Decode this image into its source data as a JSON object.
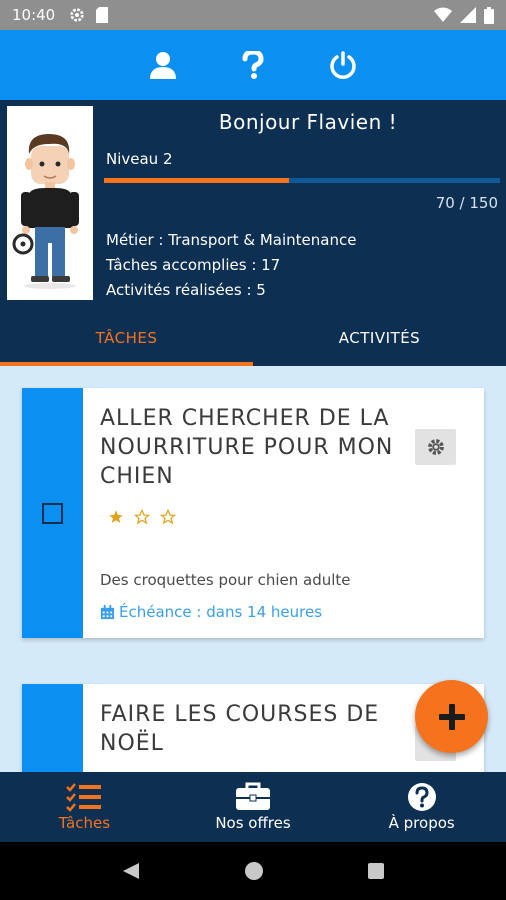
{
  "status_bar": {
    "time": "10:40",
    "icons": [
      "settings-icon",
      "sd-card-icon",
      "wifi-icon",
      "signal-icon",
      "battery-icon"
    ]
  },
  "top_bar": {
    "icons": [
      "user-icon",
      "question-icon",
      "power-icon"
    ]
  },
  "profile": {
    "greeting": "Bonjour Flavien !",
    "level": "Niveau 2",
    "xp_current": 70,
    "xp_max": 150,
    "xp_text": "70  / 150",
    "job": "Métier : Transport & Maintenance",
    "tasks_done": "Tâches accomplies : 17",
    "activities_done": "Activités réalisées : 5"
  },
  "tabs": [
    {
      "label": "TÂCHES",
      "active": true
    },
    {
      "label": "ACTIVITÉS",
      "active": false
    }
  ],
  "tasks": [
    {
      "title": "ALLER CHERCHER DE LA NOURRITURE POUR MON CHIEN",
      "stars_filled": 1,
      "stars_total": 3,
      "description": "Des croquettes pour chien adulte",
      "due": "Échéance : dans 14 heures"
    },
    {
      "title": "FAIRE LES COURSES DE NOËL"
    }
  ],
  "fab": {
    "icon": "plus-icon"
  },
  "bottom_nav": [
    {
      "label": "Tâches",
      "icon": "task-list-icon",
      "active": true
    },
    {
      "label": "Nos offres",
      "icon": "briefcase-icon",
      "active": false
    },
    {
      "label": "À propos",
      "icon": "help-circle-icon",
      "active": false
    }
  ],
  "colors": {
    "primary_blue": "#0b8ff0",
    "dark_navy": "#0c2f52",
    "accent_orange": "#f5731d",
    "background": "#d4eaf9",
    "star_gold": "#e0a21c",
    "link_blue": "#3a9ee8"
  }
}
